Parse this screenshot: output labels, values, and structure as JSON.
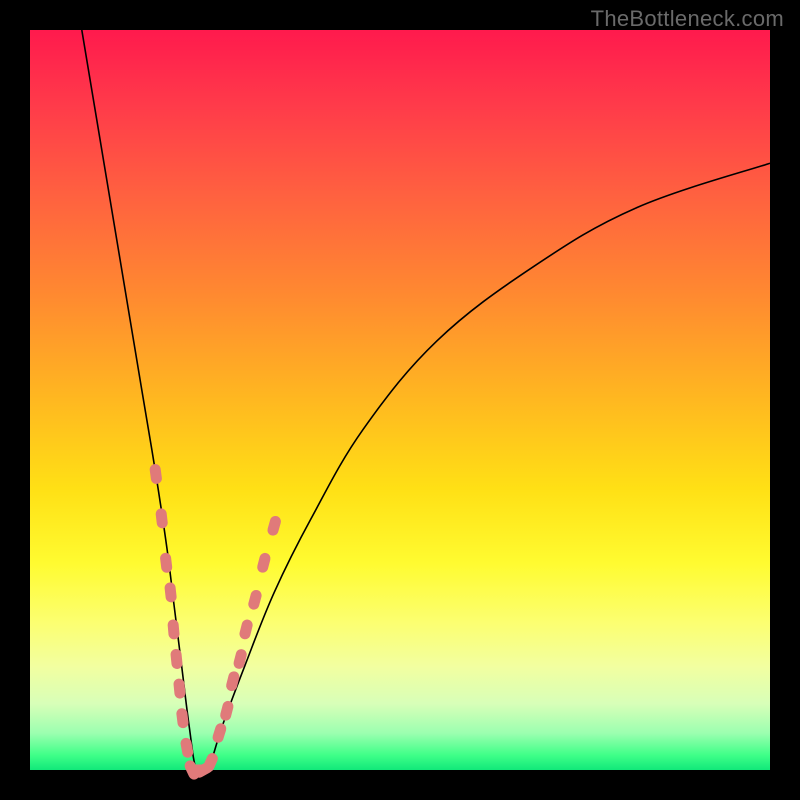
{
  "watermark": "TheBottleneck.com",
  "chart_data": {
    "type": "line",
    "title": "",
    "xlabel": "",
    "ylabel": "",
    "xlim": [
      0,
      100
    ],
    "ylim": [
      0,
      100
    ],
    "series": [
      {
        "name": "bottleneck-curve",
        "x": [
          7,
          9,
          11,
          13,
          15,
          17,
          18.5,
          19.5,
          20.5,
          21.5,
          22.5,
          24,
          26,
          29,
          33,
          38,
          45,
          55,
          68,
          82,
          100
        ],
        "y": [
          100,
          88,
          76,
          64,
          52,
          40,
          30,
          22,
          14,
          6,
          0,
          0,
          6,
          14,
          24,
          34,
          46,
          58,
          68,
          76,
          82
        ]
      }
    ],
    "annotations": {
      "highlight_points": [
        {
          "x": 17.0,
          "y": 40
        },
        {
          "x": 17.8,
          "y": 34
        },
        {
          "x": 18.4,
          "y": 28
        },
        {
          "x": 19.0,
          "y": 24
        },
        {
          "x": 19.4,
          "y": 19
        },
        {
          "x": 19.8,
          "y": 15
        },
        {
          "x": 20.2,
          "y": 11
        },
        {
          "x": 20.6,
          "y": 7
        },
        {
          "x": 21.2,
          "y": 3
        },
        {
          "x": 21.9,
          "y": 0
        },
        {
          "x": 22.6,
          "y": 0
        },
        {
          "x": 23.4,
          "y": 0
        },
        {
          "x": 24.4,
          "y": 1
        },
        {
          "x": 25.6,
          "y": 5
        },
        {
          "x": 26.6,
          "y": 8
        },
        {
          "x": 27.4,
          "y": 12
        },
        {
          "x": 28.4,
          "y": 15
        },
        {
          "x": 29.2,
          "y": 19
        },
        {
          "x": 30.4,
          "y": 23
        },
        {
          "x": 31.6,
          "y": 28
        },
        {
          "x": 33.0,
          "y": 33
        }
      ]
    }
  },
  "colors": {
    "curve": "#000000",
    "beads": "#e07a7a",
    "bg_top": "#ff1a4d",
    "bg_mid": "#ffe015",
    "bg_bottom": "#11e87a",
    "frame": "#000000",
    "watermark": "#6a6a6a"
  }
}
